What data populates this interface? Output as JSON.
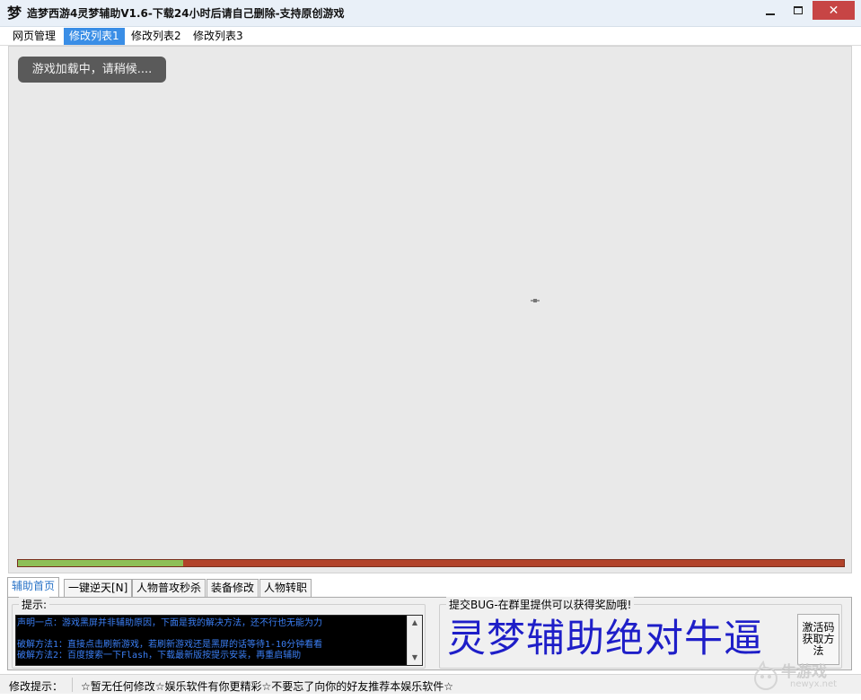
{
  "window": {
    "icon_glyph": "梦",
    "title": "造梦西游4灵梦辅助V1.6-下载24小时后请自己删除-支持原创游戏",
    "close_glyph": "✕"
  },
  "menu": [
    {
      "label": "网页管理",
      "active": false
    },
    {
      "label": "修改列表1",
      "active": true
    },
    {
      "label": "修改列表2",
      "active": false
    },
    {
      "label": "修改列表3",
      "active": false
    }
  ],
  "game": {
    "loading_text": "游戏加载中，请稍候....",
    "progress": 0.2
  },
  "tabs": [
    {
      "label": "辅助首页",
      "active": true
    },
    {
      "label": "一键逆天[N]",
      "active": false
    },
    {
      "label": "人物普攻秒杀",
      "active": false
    },
    {
      "label": "装备修改",
      "active": false
    },
    {
      "label": "人物转职",
      "active": false
    }
  ],
  "tips": {
    "title": "提示:",
    "lines": [
      "声明一点：游戏黑屏并非辅助原因，下面是我的解决方法，还不行也无能为力",
      "",
      "破解方法1：直接点击刷新游戏，若刷新游戏还是黑屏的话等待1-10分钟看看",
      "破解方法2：百度搜索一下Flash，下载最新版按提示安装，再重启辅助"
    ],
    "scroll_up_glyph": "▲",
    "scroll_down_glyph": "▼"
  },
  "promo": {
    "title": "提交BUG-在群里提供可以获得奖励哦!",
    "slogan": "灵梦辅助绝对牛逼",
    "activate_label": "激活码获取方法"
  },
  "status": {
    "label": "修改提示：",
    "text": "☆暂无任何修改☆娱乐软件有你更精彩☆不要忘了向你的好友推荐本娱乐软件☆"
  },
  "watermark": {
    "text": "牛游戏",
    "sub": "newyx.net"
  },
  "colors": {
    "menu_active": "#3a8ee6",
    "progress_fill": "#8ebf57",
    "progress_track": "#b2432a",
    "console_text": "#3b7ff5",
    "slogan": "#1e1ec8",
    "close_button": "#c74545"
  }
}
